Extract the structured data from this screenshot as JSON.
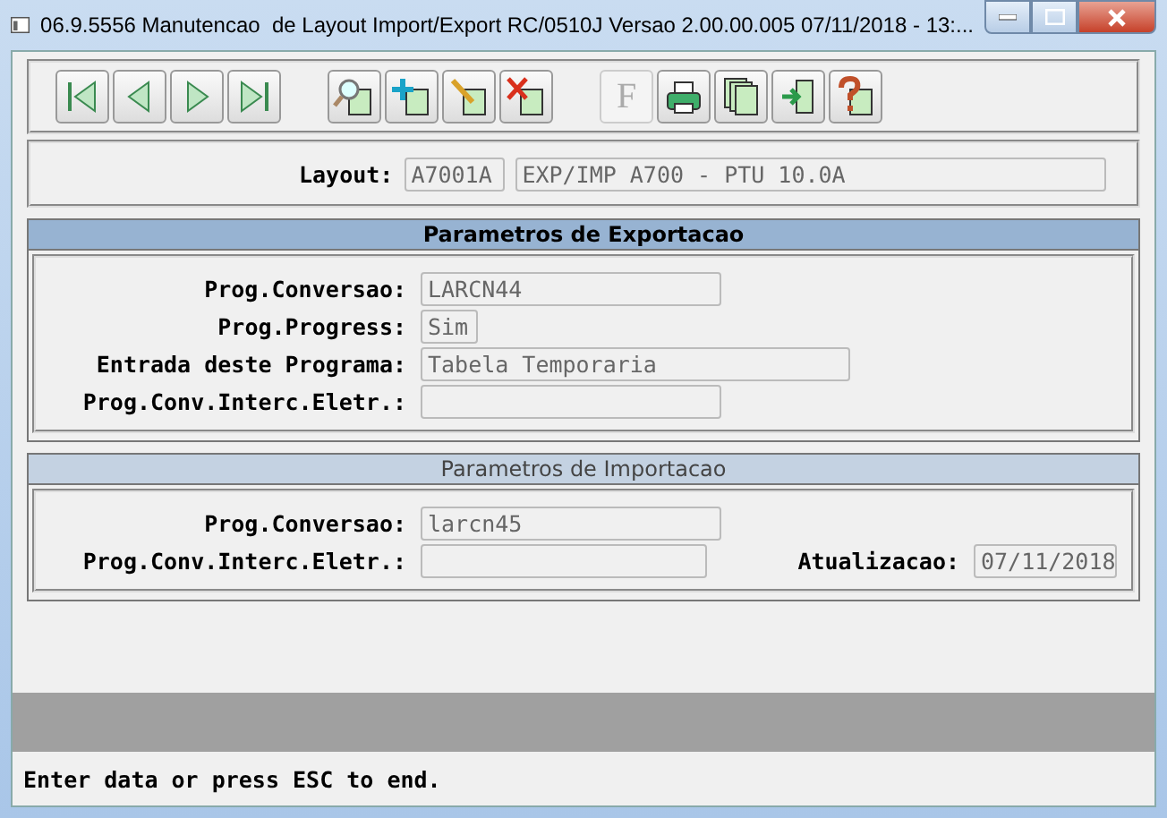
{
  "window": {
    "title": "06.9.5556 Manutencao  de Layout Import/Export RC/0510J Versao 2.00.00.005 07/11/2018 - 13:..."
  },
  "toolbar": {
    "groups": [
      [
        {
          "kind": "first",
          "disabled": false
        },
        {
          "kind": "prev",
          "disabled": false
        },
        {
          "kind": "next",
          "disabled": false
        },
        {
          "kind": "last",
          "disabled": false
        }
      ],
      [
        {
          "kind": "search",
          "disabled": false
        },
        {
          "kind": "add",
          "disabled": false
        },
        {
          "kind": "edit",
          "disabled": false
        },
        {
          "kind": "delete",
          "disabled": false
        }
      ],
      [
        {
          "kind": "filter",
          "disabled": true,
          "glyph": "F"
        },
        {
          "kind": "print",
          "disabled": false
        },
        {
          "kind": "copy",
          "disabled": false
        },
        {
          "kind": "exit",
          "disabled": false
        },
        {
          "kind": "help",
          "disabled": false
        }
      ]
    ]
  },
  "layout": {
    "label": "Layout:",
    "code": "A7001A",
    "description": "EXP/IMP A700 - PTU 10.0A"
  },
  "sections": [
    {
      "title": "Parametros de Exportacao",
      "active": true,
      "fields": [
        {
          "label": "Prog.Conversao:",
          "value": "LARCN44"
        },
        {
          "label": "Prog.Progress:",
          "value": "Sim"
        },
        {
          "label": "Entrada deste Programa:",
          "value": "Tabela Temporaria"
        },
        {
          "label": "Prog.Conv.Interc.Eletr.:"
        }
      ]
    },
    {
      "title": "Parametros de Importacao",
      "active": false,
      "fields": [
        {
          "label": "Prog.Conversao:",
          "value": "larcn45"
        },
        {
          "label": "Prog.Conv.Interc.Eletr.:"
        }
      ],
      "side_field": {
        "label": "Atualizacao:",
        "value": "07/11/2018"
      }
    }
  ],
  "status_bar": {
    "message": "Enter data or press ESC to end."
  }
}
